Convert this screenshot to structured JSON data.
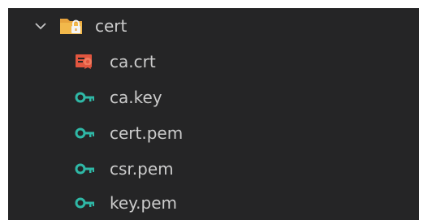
{
  "explorer": {
    "folder": {
      "name": "cert",
      "expanded": true,
      "icon": "folder-lock-icon",
      "color": "#e8a33d"
    },
    "files": [
      {
        "name": "ca.crt",
        "icon": "certificate-icon",
        "color": "#e2563f"
      },
      {
        "name": "ca.key",
        "icon": "key-icon",
        "color": "#2fb8a6"
      },
      {
        "name": "cert.pem",
        "icon": "key-icon",
        "color": "#2fb8a6"
      },
      {
        "name": "csr.pem",
        "icon": "key-icon",
        "color": "#2fb8a6"
      },
      {
        "name": "key.pem",
        "icon": "key-icon",
        "color": "#2fb8a6"
      }
    ]
  },
  "colors": {
    "background": "#252526",
    "text": "#cccccc"
  }
}
